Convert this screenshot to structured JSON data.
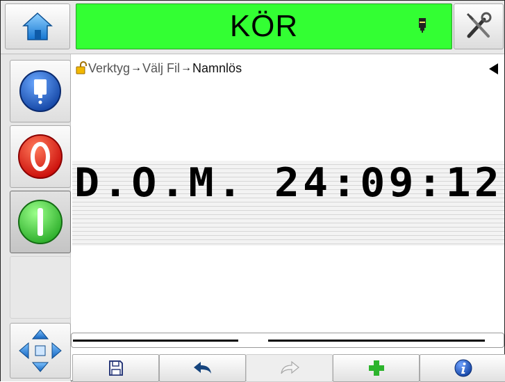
{
  "header": {
    "status_text": "KÖR",
    "status_color": "#33ff33",
    "home_icon": "home-icon",
    "ink_icon": "ink-cartridge-icon",
    "tools_icon": "tools-icon"
  },
  "sidebar": {
    "items": [
      {
        "name": "ink-system-button",
        "icon": "ink-drop-icon"
      },
      {
        "name": "stop-button",
        "icon": "stop-icon",
        "color": "#e00000"
      },
      {
        "name": "start-button",
        "icon": "start-icon",
        "color": "#2ecc2e",
        "active": true
      },
      {
        "name": "empty-button"
      },
      {
        "name": "navigation-button",
        "icon": "direction-arrows-icon"
      }
    ]
  },
  "breadcrumb": {
    "lock_icon": "unlocked-padlock-icon",
    "items": [
      "Verktyg",
      "Välj Fil",
      "Namnlös"
    ],
    "separator": "→"
  },
  "editor": {
    "message_text": "D.O.M. 24:09:12"
  },
  "toolbar": {
    "buttons": [
      {
        "name": "save",
        "icon": "save-icon"
      },
      {
        "name": "undo",
        "icon": "undo-icon"
      },
      {
        "name": "redo",
        "icon": "redo-icon",
        "disabled": true
      },
      {
        "name": "add",
        "icon": "plus-icon",
        "color": "#2db42d"
      },
      {
        "name": "info",
        "icon": "info-icon",
        "color": "#1a52c4"
      }
    ]
  }
}
